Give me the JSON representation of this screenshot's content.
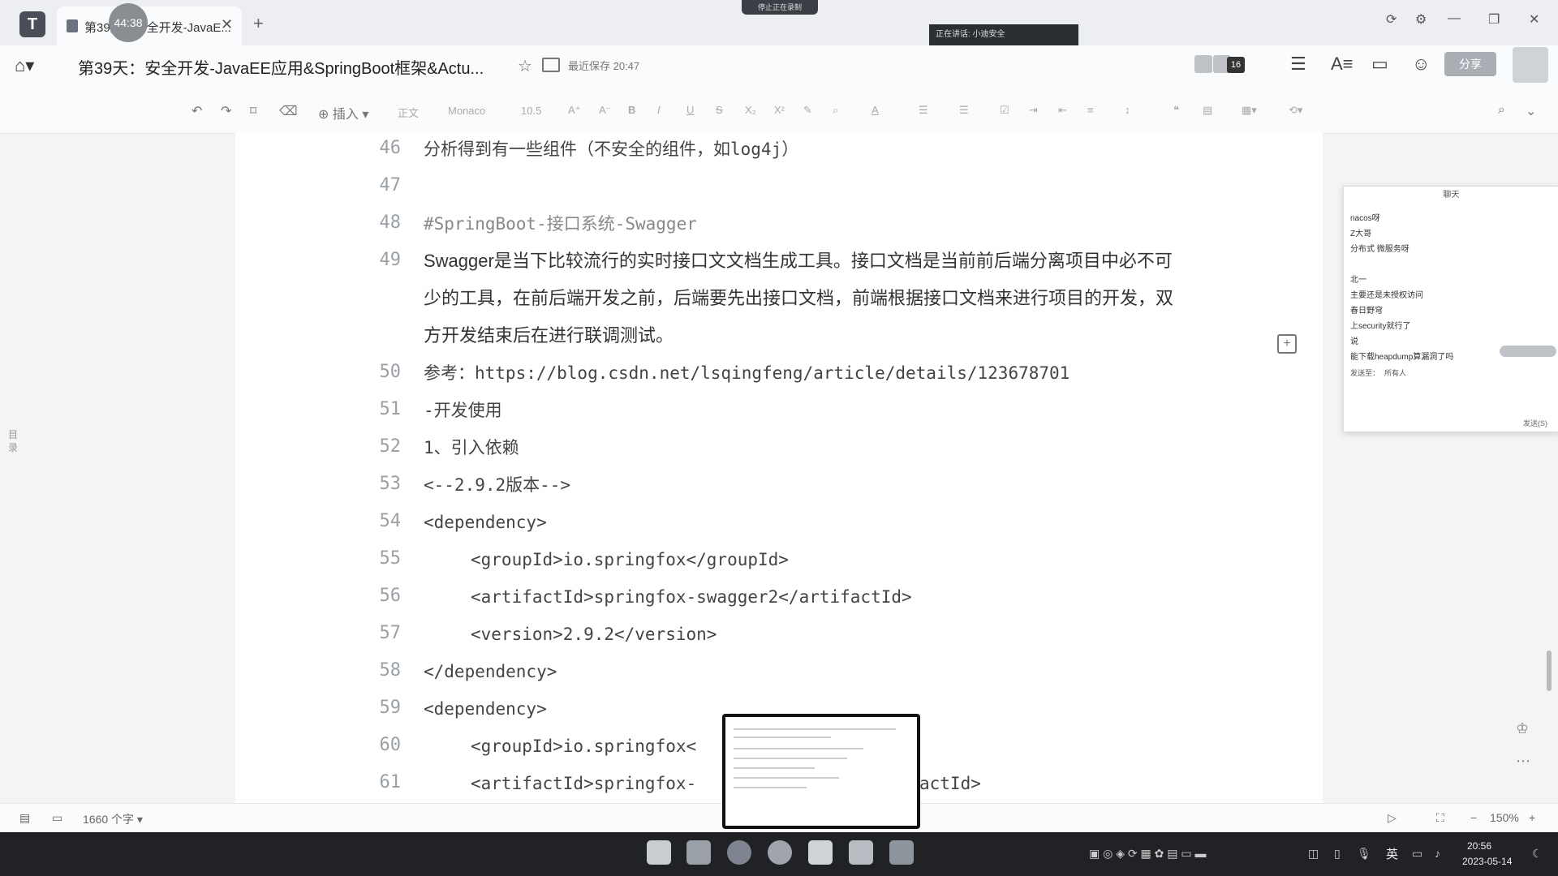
{
  "tabs": {
    "active_label": "第39天：安全开发-JavaE...",
    "timer": "44:38",
    "record_pill": "停止正在录制"
  },
  "meeting": {
    "speaking": "正在讲话: 小迪安全"
  },
  "title_row": {
    "title": "第39天：安全开发-JavaEE应用&SpringBoot框架&Actu...",
    "save_status": "最近保存 20:47",
    "collab_count": "16",
    "share_label": "分享"
  },
  "toolbar": {
    "insert_label": "插入",
    "paragraph_label": "正文",
    "font": "Monaco",
    "size": "10.5"
  },
  "document": {
    "lines": [
      {
        "n": "46",
        "text": "分析得到有一些组件（不安全的组件，如log4j）"
      },
      {
        "n": "47",
        "text": ""
      },
      {
        "n": "48",
        "text": "#SpringBoot-接口系统-Swagger"
      },
      {
        "n": "49",
        "text": "Swagger是当下比较流行的实时接口文文档生成工具。接口文档是当前前后端分离项目中必不可少的工具，在前后端开发之前，后端要先出接口文档，前端根据接口文档来进行项目的开发，双方开发结束后在进行联调测试。"
      },
      {
        "n": "50",
        "text": "参考：https://blog.csdn.net/lsqingfeng/article/details/123678701"
      },
      {
        "n": "51",
        "text": "-开发使用"
      },
      {
        "n": "52",
        "text": "1、引入依赖"
      },
      {
        "n": "53",
        "text": "<--2.9.2版本-->"
      },
      {
        "n": "54",
        "text": "<dependency>"
      },
      {
        "n": "55",
        "text": "<groupId>io.springfox</groupId>"
      },
      {
        "n": "56",
        "text": "<artifactId>springfox-swagger2</artifactId>"
      },
      {
        "n": "57",
        "text": "<version>2.9.2</version>"
      },
      {
        "n": "58",
        "text": "</dependency>"
      },
      {
        "n": "59",
        "text": "<dependency>"
      },
      {
        "n": "60",
        "text": "<groupId>io.springfox<"
      },
      {
        "n": "61",
        "text": "<artifactId>springfox-"
      },
      {
        "n": "61b",
        "text": "actId>"
      }
    ]
  },
  "chat": {
    "title": "聊天",
    "messages": [
      "nacos呀",
      "Z大哥",
      "分布式 微服务呀",
      "北一",
      "主要还是未授权访问",
      "春日野穹",
      "上security就行了",
      "说",
      "能下载heapdump算漏洞了吗"
    ],
    "to_label": "发送至：",
    "to_value": "所有人",
    "send_label": "发送(S)"
  },
  "status_bar": {
    "word_count": "1660 个字",
    "zoom": "150%"
  },
  "taskbar": {
    "ime": "英",
    "time": "20:56",
    "date": "2023-05-14"
  }
}
